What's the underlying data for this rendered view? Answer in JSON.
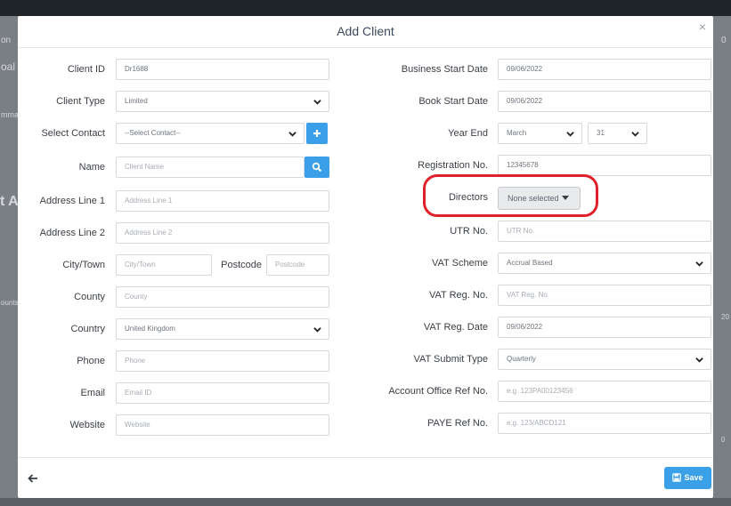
{
  "background": {
    "left_fragments": [
      "on",
      "oal",
      "mma",
      "t A",
      "ounts"
    ],
    "right_fragments": [
      "0",
      "20",
      "0"
    ]
  },
  "modal": {
    "title": "Add Client",
    "close_icon": "×"
  },
  "left": {
    "client_id": {
      "label": "Client ID",
      "value": "Dr1688"
    },
    "client_type": {
      "label": "Client Type",
      "value": "Limited"
    },
    "select_contact": {
      "label": "Select Contact",
      "value": "--Select Contact--"
    },
    "name": {
      "label": "Name",
      "placeholder": "Client Name"
    },
    "address1": {
      "label": "Address Line 1",
      "placeholder": "Address Line 1"
    },
    "address2": {
      "label": "Address Line 2",
      "placeholder": "Address Line 2"
    },
    "city": {
      "label": "City/Town",
      "placeholder": "City/Town"
    },
    "postcode": {
      "label": "Postcode",
      "placeholder": "Postcode"
    },
    "county": {
      "label": "County",
      "placeholder": "County"
    },
    "country": {
      "label": "Country",
      "value": "United Kingdom"
    },
    "phone": {
      "label": "Phone",
      "placeholder": "Phone"
    },
    "email": {
      "label": "Email",
      "placeholder": "Email ID"
    },
    "website": {
      "label": "Website",
      "placeholder": "Website"
    }
  },
  "right": {
    "business_start": {
      "label": "Business Start Date",
      "value": "09/06/2022"
    },
    "book_start": {
      "label": "Book Start Date",
      "value": "09/06/2022"
    },
    "year_end": {
      "label": "Year End",
      "month": "March",
      "day": "31"
    },
    "registration": {
      "label": "Registration No.",
      "value": "12345678"
    },
    "directors": {
      "label": "Directors",
      "value": "None selected"
    },
    "utr": {
      "label": "UTR No.",
      "placeholder": "UTR No."
    },
    "vat_scheme": {
      "label": "VAT Scheme",
      "value": "Accrual Based"
    },
    "vat_reg_no": {
      "label": "VAT Reg. No.",
      "placeholder": "VAT Reg. No."
    },
    "vat_reg_date": {
      "label": "VAT Reg. Date",
      "value": "09/06/2022"
    },
    "vat_submit": {
      "label": "VAT Submit Type",
      "value": "Quarterly"
    },
    "account_office": {
      "label": "Account Office Ref No.",
      "placeholder": "e.g. 123PA00123456"
    },
    "paye": {
      "label": "PAYE Ref No.",
      "placeholder": "e.g. 123/ABCD121"
    }
  },
  "footer": {
    "save_label": "Save"
  },
  "colors": {
    "accent": "#3a9ee8",
    "annotation": "#e0202a"
  }
}
